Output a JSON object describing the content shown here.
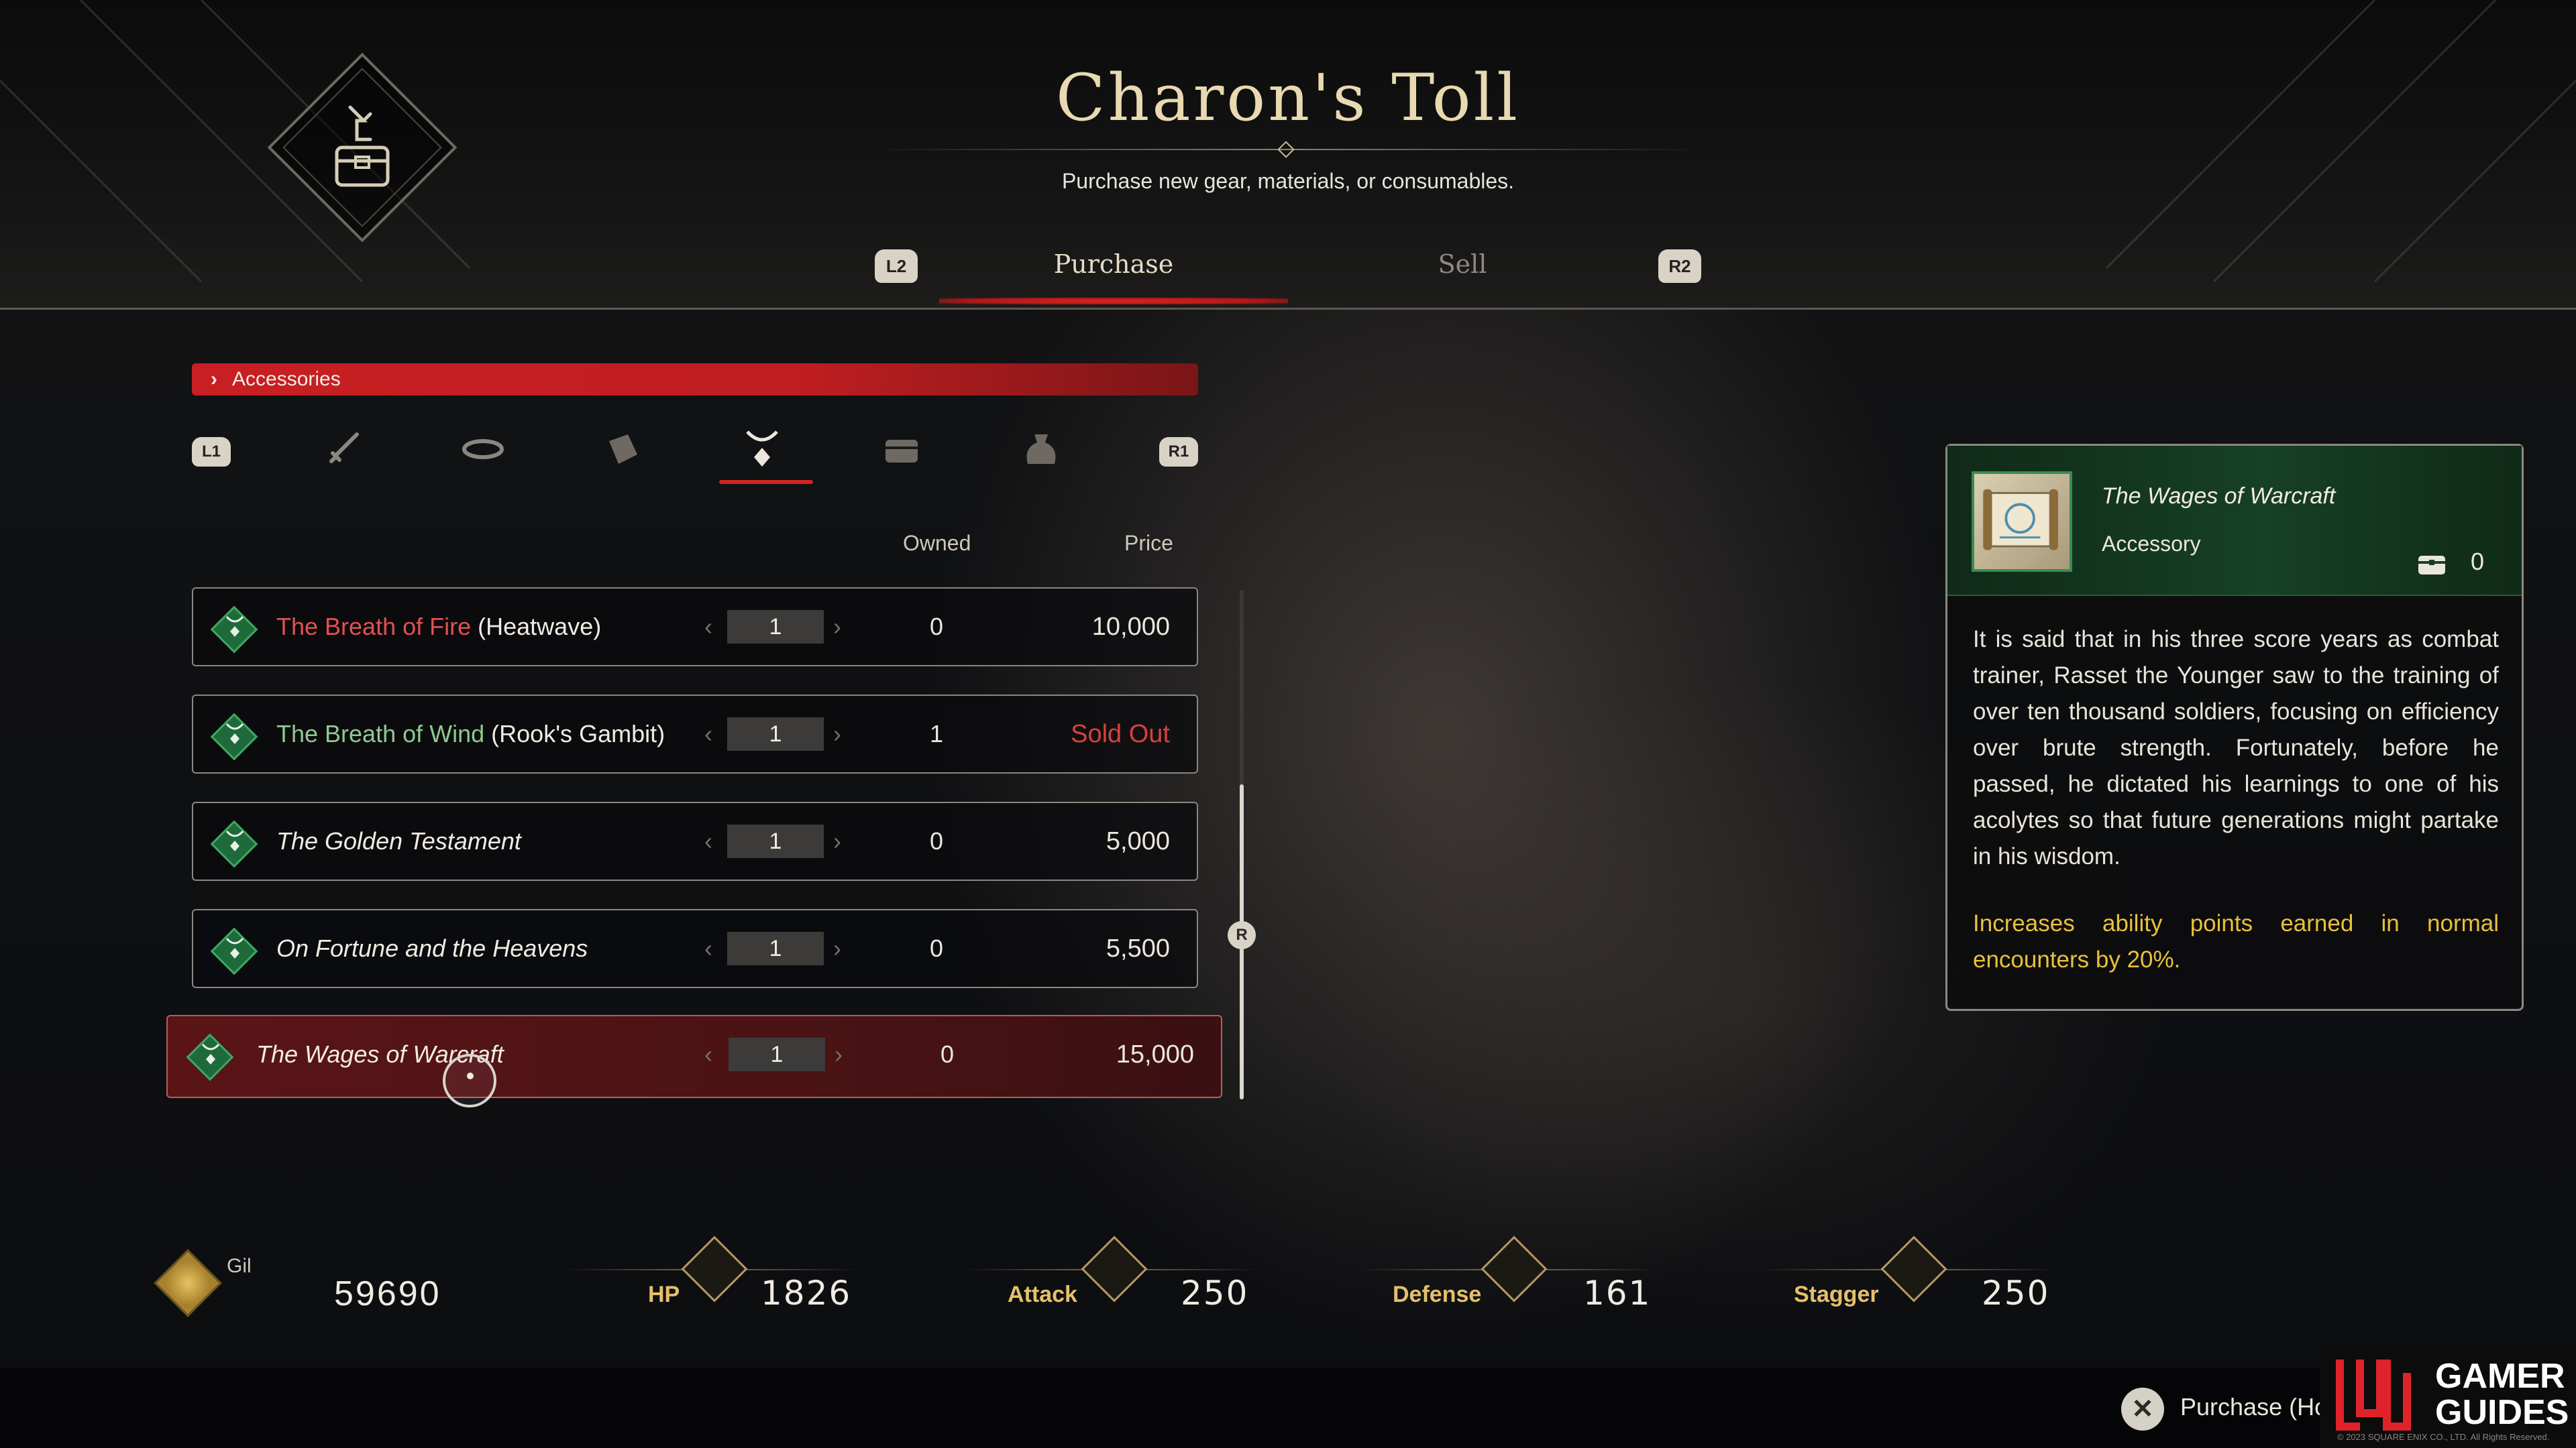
{
  "header": {
    "title": "Charon's Toll",
    "subtitle": "Purchase new gear, materials, or consumables.",
    "left_trigger": "L2",
    "right_trigger": "R2",
    "tabs": [
      {
        "label": "Purchase",
        "active": true
      },
      {
        "label": "Sell",
        "active": false
      }
    ]
  },
  "category": {
    "banner": "Accessories",
    "left_bumper": "L1",
    "right_bumper": "R1",
    "icons": [
      "sword-icon",
      "belt-icon",
      "bracer-icon",
      "amulet-icon",
      "chest-icon",
      "pouch-icon"
    ],
    "selected_index": 3
  },
  "columns": {
    "owned": "Owned",
    "price": "Price"
  },
  "items": [
    {
      "name_colored": "The Breath of Fire",
      "name_color": "red",
      "name_suffix": " (Heatwave)",
      "italic": false,
      "qty": "1",
      "owned": "0",
      "price": "10,000",
      "sold_out": false,
      "selected": false
    },
    {
      "name_colored": "The Breath of Wind",
      "name_color": "green",
      "name_suffix": " (Rook's Gambit)",
      "italic": false,
      "qty": "1",
      "owned": "1",
      "price": "Sold Out",
      "sold_out": true,
      "selected": false
    },
    {
      "name_colored": "",
      "name_color": "",
      "name_suffix": "The Golden Testament",
      "italic": true,
      "qty": "1",
      "owned": "0",
      "price": "5,000",
      "sold_out": false,
      "selected": false
    },
    {
      "name_colored": "",
      "name_color": "",
      "name_suffix": "On Fortune and the Heavens",
      "italic": true,
      "qty": "1",
      "owned": "0",
      "price": "5,500",
      "sold_out": false,
      "selected": false
    },
    {
      "name_colored": "",
      "name_color": "",
      "name_suffix": "The Wages of Warcraft",
      "italic": true,
      "qty": "1",
      "owned": "0",
      "price": "15,000",
      "sold_out": false,
      "selected": true
    }
  ],
  "scroll": {
    "button": "R"
  },
  "detail": {
    "name": "The Wages of Warcraft",
    "type": "Accessory",
    "owned": "0",
    "description": "It is said that in his three score years as combat trainer, Rasset the Younger saw to the training of over ten thousand soldiers, focusing on efficiency over brute strength. Fortunately, before he passed, he dictated his learnings to one of his acolytes so that future generations might partake in his wisdom.",
    "effect": "Increases ability points earned in normal encounters by 20%."
  },
  "stats": {
    "gil_label": "Gil",
    "gil": "59690",
    "hp_label": "HP",
    "hp": "1826",
    "attack_label": "Attack",
    "attack": "250",
    "defense_label": "Defense",
    "defense": "161",
    "stagger_label": "Stagger",
    "stagger": "250"
  },
  "footer": {
    "action_button": "✕",
    "action_label": "Purchase (Hold)",
    "logo_line1": "GAMER",
    "logo_line2": "GUIDES",
    "copyright": "© 2023 SQUARE ENIX CO., LTD. All Rights Reserved."
  },
  "colors": {
    "accent_red": "#c81f22",
    "effect_yellow": "#e9c13a",
    "item_green": "#3ea762"
  }
}
